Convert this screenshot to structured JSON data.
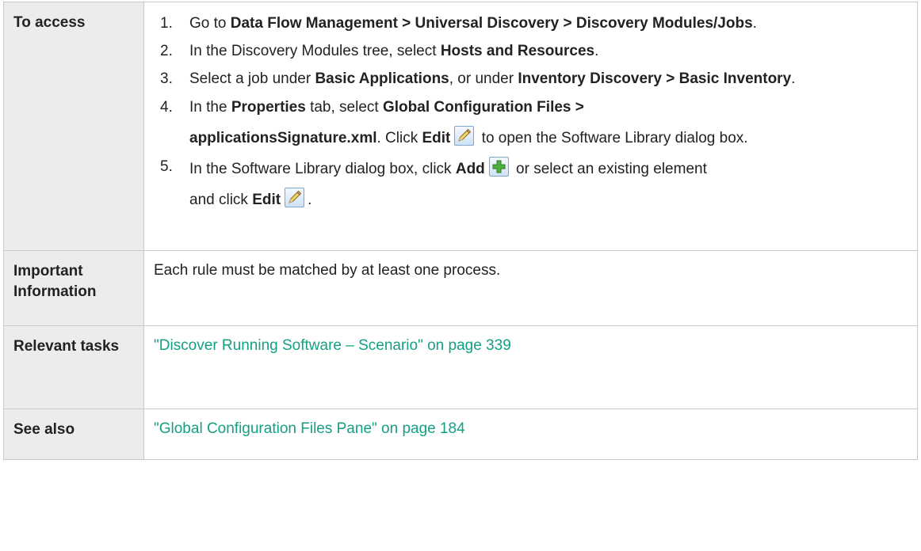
{
  "rows": {
    "access": {
      "label": "To access",
      "steps": [
        {
          "num": "1.",
          "t1": "Go to ",
          "b1": "Data Flow Management > Universal Discovery > Discovery Modules/Jobs",
          "t2": "."
        },
        {
          "num": "2.",
          "t1": "In the Discovery Modules tree, select ",
          "b1": "Hosts and Resources",
          "t2": "."
        },
        {
          "num": "3.",
          "t1": "Select a job under ",
          "b1": "Basic Applications",
          "t2": ", or under ",
          "b2": "Inventory Discovery > Basic Inventory",
          "t3": "."
        },
        {
          "num": "4.",
          "t1": "In the ",
          "b1": "Properties",
          "t2": " tab, select ",
          "b2": "Global Configuration Files >",
          "b3": "applicationsSignature.xml",
          "t3": ". Click ",
          "b4": "Edit",
          "t4": " to open the Software Library dialog box."
        },
        {
          "num": "5.",
          "t1": "In the Software Library dialog box, click ",
          "b1": "Add",
          "t2": " or select an existing element",
          "t3": "and click ",
          "b2": "Edit",
          "t4": "."
        }
      ]
    },
    "important": {
      "label": "Important Information",
      "text": "Each rule must be matched by at least one process."
    },
    "relevant": {
      "label": "Relevant tasks",
      "link": "\"Discover Running Software – Scenario\" on page 339"
    },
    "see_also": {
      "label": "See also",
      "link": "\"Global Configuration Files Pane\" on page 184"
    }
  },
  "icons": {
    "edit": "pencil-edit-icon",
    "add": "green-plus-add-icon"
  },
  "colors": {
    "link": "#14a083",
    "label_bg": "#ececec",
    "border": "#c9c9c9",
    "text": "#222222"
  }
}
